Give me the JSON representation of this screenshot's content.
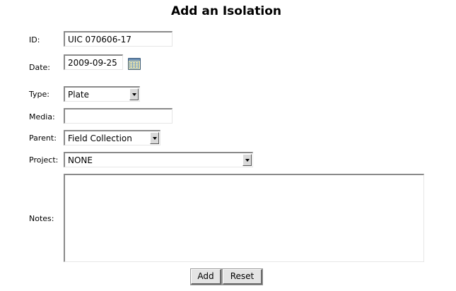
{
  "page": {
    "title": "Add an Isolation"
  },
  "form": {
    "id": {
      "label": "ID:",
      "value": "UIC 070606-17"
    },
    "date": {
      "label": "Date:",
      "value": "2009-09-25",
      "icon": "calendar-icon"
    },
    "type": {
      "label": "Type:",
      "selected": "Plate"
    },
    "media": {
      "label": "Media:",
      "value": ""
    },
    "parent": {
      "label": "Parent:",
      "selected": "Field Collection"
    },
    "project": {
      "label": "Project:",
      "selected": "NONE"
    },
    "notes": {
      "label": "Notes:",
      "value": ""
    }
  },
  "buttons": {
    "add": "Add",
    "reset": "Reset"
  }
}
